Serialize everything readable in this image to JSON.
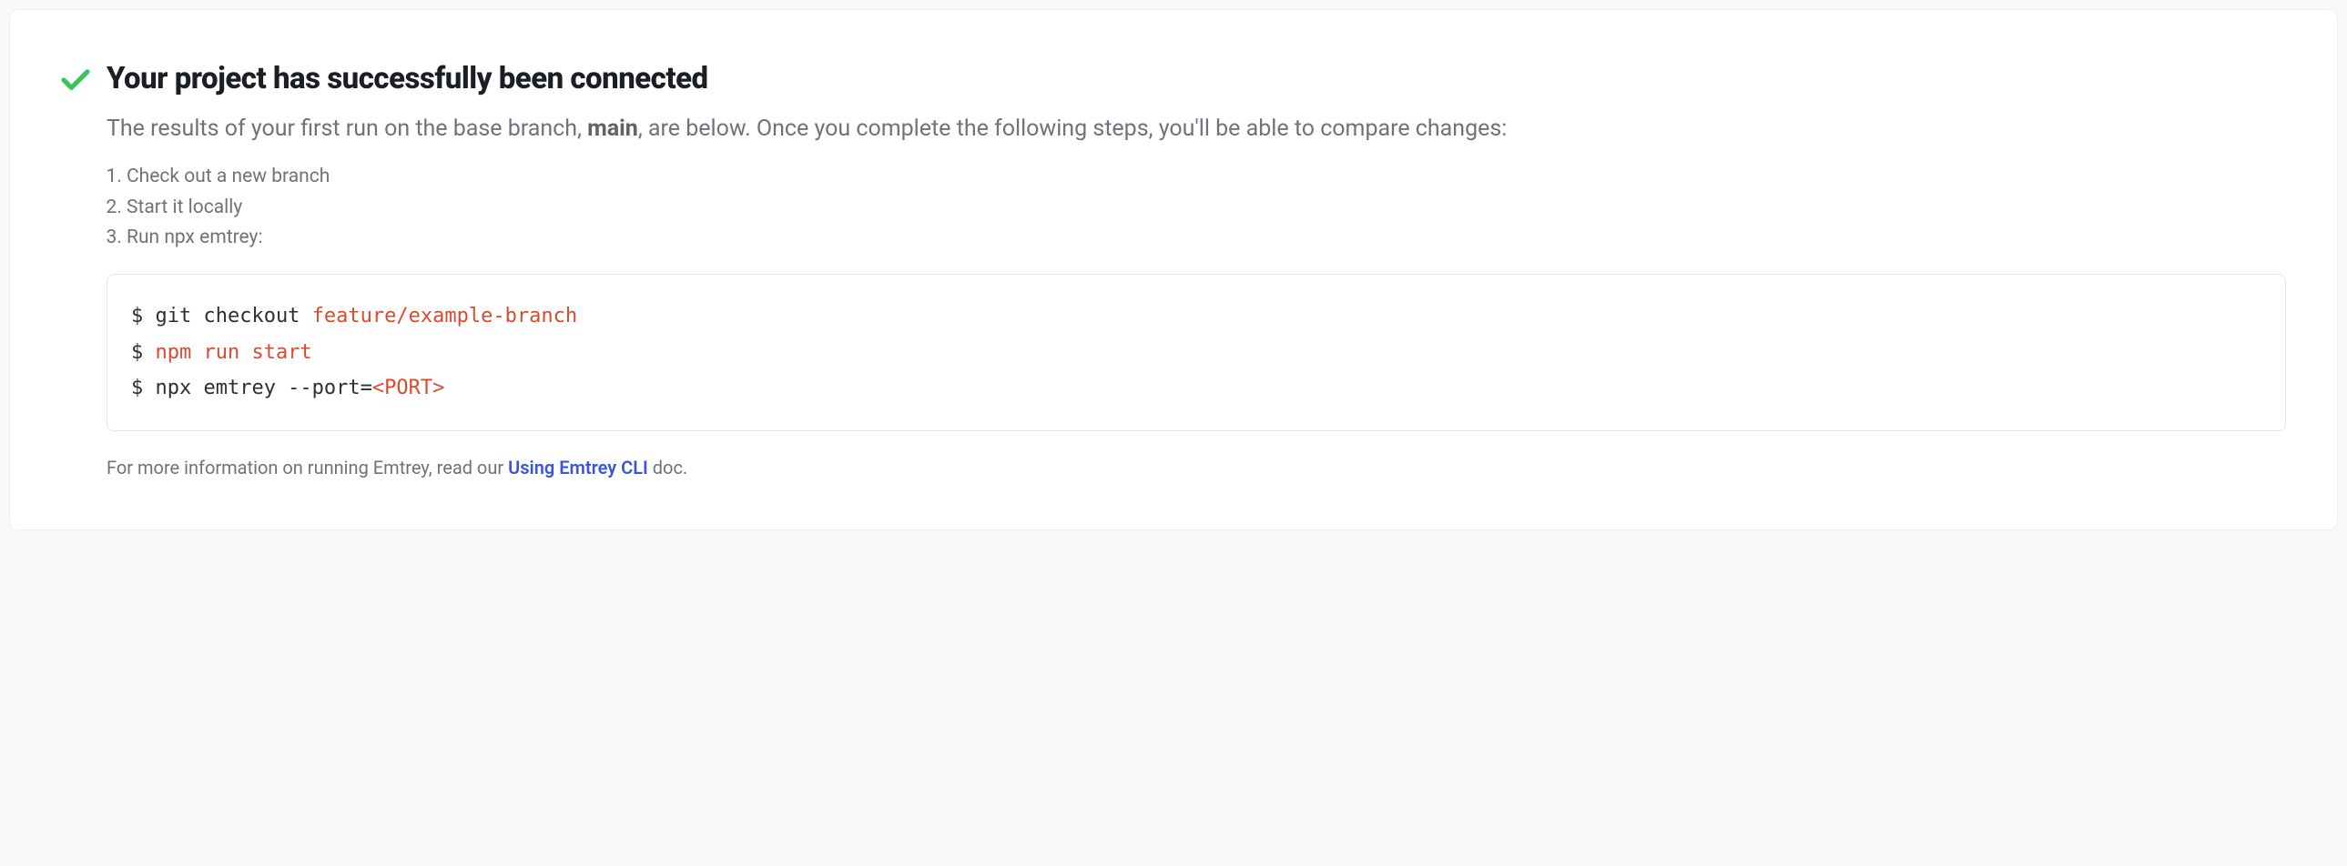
{
  "title": "Your project has successfully been connected",
  "subtitle_before": "The results of your first run on the base branch, ",
  "subtitle_branch": "main",
  "subtitle_after": ", are below. Once you complete the following steps, you'll be able to compare changes:",
  "steps": {
    "s1": "Check out a new branch",
    "s2": "Start it locally",
    "s3": "Run npx emtrey:"
  },
  "code": {
    "l1a": "$ git checkout ",
    "l1b": "feature/example-branch",
    "l2a": "$ ",
    "l2b": "npm run start",
    "l3a": "$ npx emtrey --port=",
    "l3b": "<PORT>"
  },
  "foot_before": "For more information on running Emtrey, read our ",
  "foot_link": "Using Emtrey CLI",
  "foot_after": " doc."
}
